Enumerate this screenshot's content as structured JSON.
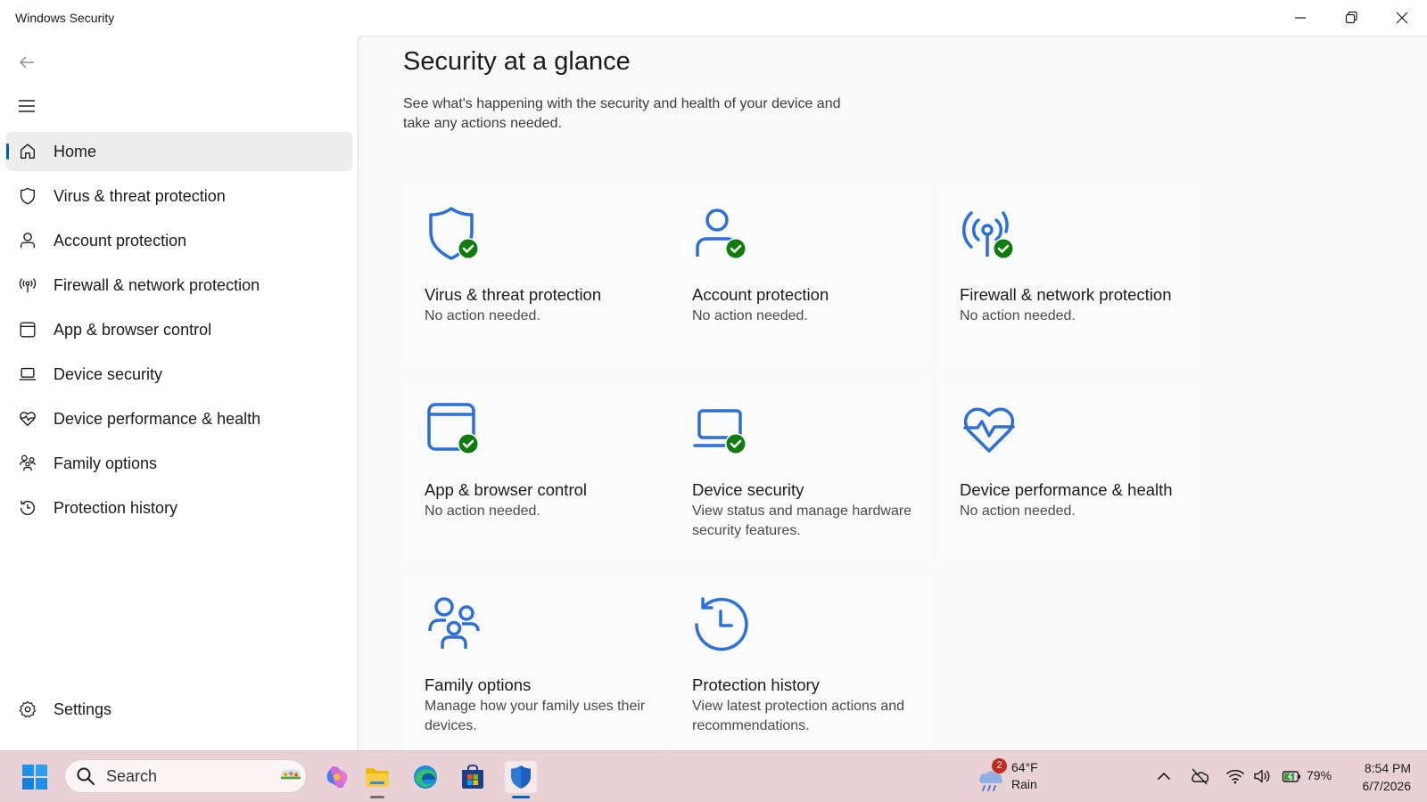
{
  "window": {
    "title": "Windows Security",
    "controls": [
      "minimize-icon",
      "restore-icon",
      "close-icon"
    ]
  },
  "sidebar": {
    "items": [
      {
        "label": "Home",
        "icon": "home-icon",
        "active": true
      },
      {
        "label": "Virus & threat protection",
        "icon": "shield-icon"
      },
      {
        "label": "Account protection",
        "icon": "person-icon"
      },
      {
        "label": "Firewall & network protection",
        "icon": "antenna-icon"
      },
      {
        "label": "App & browser control",
        "icon": "app-window-icon"
      },
      {
        "label": "Device security",
        "icon": "laptop-icon"
      },
      {
        "label": "Device performance & health",
        "icon": "heart-pulse-icon"
      },
      {
        "label": "Family options",
        "icon": "family-icon"
      },
      {
        "label": "Protection history",
        "icon": "history-icon"
      }
    ],
    "settings_label": "Settings"
  },
  "main": {
    "title": "Security at a glance",
    "description": "See what's happening with the security and health of your device and take any actions needed.",
    "cards": [
      {
        "title": "Virus & threat protection",
        "status": "No action needed.",
        "icon": "shield-check-icon"
      },
      {
        "title": "Account protection",
        "status": "No action needed.",
        "icon": "person-check-icon"
      },
      {
        "title": "Firewall & network protection",
        "status": "No action needed.",
        "icon": "antenna-check-icon"
      },
      {
        "title": "App & browser control",
        "status": "No action needed.",
        "icon": "app-window-check-icon"
      },
      {
        "title": "Device security",
        "status": "View status and manage hardware security features.",
        "icon": "laptop-check-icon"
      },
      {
        "title": "Device performance & health",
        "status": "No action needed.",
        "icon": "heart-pulse-icon"
      },
      {
        "title": "Family options",
        "status": "Manage how your family uses their devices.",
        "icon": "family-icon"
      },
      {
        "title": "Protection history",
        "status": "View latest protection actions and recommendations.",
        "icon": "history-icon"
      }
    ]
  },
  "taskbar": {
    "search_label": "Search",
    "weather": {
      "temp": "64°F",
      "condition": "Rain",
      "badge": "2"
    },
    "battery": "79%",
    "time": "8:54 PM",
    "date": "6/7/2026"
  },
  "colors": {
    "accent": "#005fb8",
    "icon_blue": "#2d6fd6",
    "check_green": "#107c10",
    "taskbar": "#e9d2d6"
  }
}
